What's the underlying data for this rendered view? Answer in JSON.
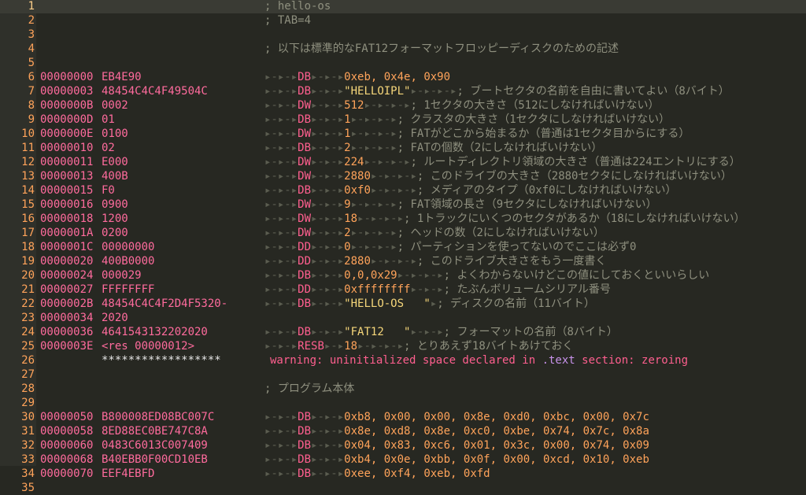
{
  "listing": [
    {
      "n": "1",
      "addr": "",
      "hex": "",
      "tab1": "",
      "dir": "",
      "tab2": "",
      "operand": "",
      "otype": "",
      "tab3": "",
      "comment": "; hello-os"
    },
    {
      "n": "2",
      "addr": "",
      "hex": "",
      "tab1": "",
      "dir": "",
      "tab2": "",
      "operand": "",
      "otype": "",
      "tab3": "",
      "comment": "; TAB=4"
    },
    {
      "n": "3",
      "addr": "",
      "hex": "",
      "tab1": "",
      "dir": "",
      "tab2": "",
      "operand": "",
      "otype": "",
      "tab3": "",
      "comment": ""
    },
    {
      "n": "4",
      "addr": "",
      "hex": "",
      "tab1": "",
      "dir": "",
      "tab2": "",
      "operand": "",
      "otype": "",
      "tab3": "",
      "comment": "; 以下は標準的なFAT12フォーマットフロッピーディスクのための記述"
    },
    {
      "n": "5",
      "addr": "",
      "hex": "",
      "tab1": "",
      "dir": "",
      "tab2": "",
      "operand": "",
      "otype": "",
      "tab3": "",
      "comment": ""
    },
    {
      "n": "6",
      "addr": "00000000",
      "hex": "EB4E90",
      "tab1": "▸-▸-▸",
      "dir": "DB",
      "tab2": "▸-▸-▸",
      "operand": "0xeb, 0x4e, 0x90",
      "otype": "num",
      "tab3": "",
      "comment": ""
    },
    {
      "n": "7",
      "addr": "00000003",
      "hex": "48454C4C4F49504C",
      "tab1": "▸-▸-▸",
      "dir": "DB",
      "tab2": "▸-▸-▸",
      "operand": "\"HELLOIPL\"",
      "otype": "str",
      "tab3": "▸-▸-▸-▸",
      "comment": "; ブートセクタの名前を自由に書いてよい（8バイト）"
    },
    {
      "n": "8",
      "addr": "0000000B",
      "hex": "0002",
      "tab1": "▸-▸-▸",
      "dir": "DW",
      "tab2": "▸-▸-▸",
      "operand": "512",
      "otype": "num",
      "tab3": "▸-▸-▸-▸",
      "comment": "; 1セクタの大きさ（512にしなければいけない）"
    },
    {
      "n": "9",
      "addr": "0000000D",
      "hex": "01",
      "tab1": "▸-▸-▸",
      "dir": "DB",
      "tab2": "▸-▸-▸",
      "operand": "1",
      "otype": "num",
      "tab3": "▸-▸-▸-▸",
      "comment": "; クラスタの大きさ（1セクタにしなければいけない）"
    },
    {
      "n": "10",
      "addr": "0000000E",
      "hex": "0100",
      "tab1": "▸-▸-▸",
      "dir": "DW",
      "tab2": "▸-▸-▸",
      "operand": "1",
      "otype": "num",
      "tab3": "▸-▸-▸-▸",
      "comment": "; FATがどこから始まるか（普通は1セクタ目からにする）"
    },
    {
      "n": "11",
      "addr": "00000010",
      "hex": "02",
      "tab1": "▸-▸-▸",
      "dir": "DB",
      "tab2": "▸-▸-▸",
      "operand": "2",
      "otype": "num",
      "tab3": "▸-▸-▸-▸",
      "comment": "; FATの個数（2にしなければいけない）"
    },
    {
      "n": "12",
      "addr": "00000011",
      "hex": "E000",
      "tab1": "▸-▸-▸",
      "dir": "DW",
      "tab2": "▸-▸-▸",
      "operand": "224",
      "otype": "num",
      "tab3": "▸-▸-▸-▸",
      "comment": "; ルートディレクトリ領域の大きさ（普通は224エントリにする）"
    },
    {
      "n": "13",
      "addr": "00000013",
      "hex": "400B",
      "tab1": "▸-▸-▸",
      "dir": "DW",
      "tab2": "▸-▸-▸",
      "operand": "2880",
      "otype": "num",
      "tab3": "▸-▸-▸-▸",
      "comment": "; このドライブの大きさ（2880セクタにしなければいけない）"
    },
    {
      "n": "14",
      "addr": "00000015",
      "hex": "F0",
      "tab1": "▸-▸-▸",
      "dir": "DB",
      "tab2": "▸-▸-▸",
      "operand": "0xf0",
      "otype": "num",
      "tab3": "▸-▸-▸-▸",
      "comment": "; メディアのタイプ（0xf0にしなければいけない）"
    },
    {
      "n": "15",
      "addr": "00000016",
      "hex": "0900",
      "tab1": "▸-▸-▸",
      "dir": "DW",
      "tab2": "▸-▸-▸",
      "operand": "9",
      "otype": "num",
      "tab3": "▸-▸-▸-▸",
      "comment": "; FAT領域の長さ（9セクタにしなければいけない）"
    },
    {
      "n": "16",
      "addr": "00000018",
      "hex": "1200",
      "tab1": "▸-▸-▸",
      "dir": "DW",
      "tab2": "▸-▸-▸",
      "operand": "18",
      "otype": "num",
      "tab3": "▸-▸-▸-▸",
      "comment": "; 1トラックにいくつのセクタがあるか（18にしなければいけない）"
    },
    {
      "n": "17",
      "addr": "0000001A",
      "hex": "0200",
      "tab1": "▸-▸-▸",
      "dir": "DW",
      "tab2": "▸-▸-▸",
      "operand": "2",
      "otype": "num",
      "tab3": "▸-▸-▸-▸",
      "comment": "; ヘッドの数（2にしなければいけない）"
    },
    {
      "n": "18",
      "addr": "0000001C",
      "hex": "00000000",
      "tab1": "▸-▸-▸",
      "dir": "DD",
      "tab2": "▸-▸-▸",
      "operand": "0",
      "otype": "num",
      "tab3": "▸-▸-▸-▸",
      "comment": "; パーティションを使ってないのでここは必ず0"
    },
    {
      "n": "19",
      "addr": "00000020",
      "hex": "400B0000",
      "tab1": "▸-▸-▸",
      "dir": "DD",
      "tab2": "▸-▸-▸",
      "operand": "2880",
      "otype": "num",
      "tab3": "▸-▸-▸-▸",
      "comment": "; このドライブ大きさをもう一度書く"
    },
    {
      "n": "20",
      "addr": "00000024",
      "hex": "000029",
      "tab1": "▸-▸-▸",
      "dir": "DB",
      "tab2": "▸-▸-▸",
      "operand": "0,0,0x29",
      "otype": "num",
      "tab3": "▸-▸-▸-▸",
      "comment": "; よくわからないけどこの値にしておくといいらしい"
    },
    {
      "n": "21",
      "addr": "00000027",
      "hex": "FFFFFFFF",
      "tab1": "▸-▸-▸",
      "dir": "DD",
      "tab2": "▸-▸-▸",
      "operand": "0xffffffff",
      "otype": "num",
      "tab3": "▸-▸-▸",
      "comment": "; たぶんボリュームシリアル番号"
    },
    {
      "n": "22",
      "addr": "0000002B",
      "hex": "48454C4C4F2D4F5320-",
      "tab1": "▸-▸-▸",
      "dir": "DB",
      "tab2": "▸-▸-▸",
      "operand": "\"HELLO-OS   \"",
      "otype": "str",
      "tab3": "▸",
      "comment": "; ディスクの名前（11バイト）"
    },
    {
      "n": "23",
      "addr": "00000034",
      "hex": "2020",
      "tab1": "",
      "dir": "",
      "tab2": "",
      "operand": "",
      "otype": "",
      "tab3": "",
      "comment": ""
    },
    {
      "n": "24",
      "addr": "00000036",
      "hex": "4641543132202020",
      "tab1": "▸-▸-▸",
      "dir": "DB",
      "tab2": "▸-▸-▸",
      "operand": "\"FAT12   \"",
      "otype": "str",
      "tab3": "▸-▸-▸",
      "comment": "; フォーマットの名前（8バイト）"
    },
    {
      "n": "25",
      "addr": "0000003E",
      "hex": "<res 00000012>",
      "tab1": "▸-▸-▸",
      "dir": "RESB",
      "tab2": "▸-▸",
      "operand": "18",
      "otype": "num",
      "tab3": "▸-▸-▸-▸",
      "comment": "; とりあえず18バイトあけておく"
    },
    {
      "n": "26",
      "addr": "",
      "hex": "******************",
      "tab1": "",
      "dir": "",
      "tab2": "",
      "operand": "",
      "otype": "",
      "tab3": "",
      "comment": "",
      "warning": true
    },
    {
      "n": "27",
      "addr": "",
      "hex": "",
      "tab1": "",
      "dir": "",
      "tab2": "",
      "operand": "",
      "otype": "",
      "tab3": "",
      "comment": ""
    },
    {
      "n": "28",
      "addr": "",
      "hex": "",
      "tab1": "",
      "dir": "",
      "tab2": "",
      "operand": "",
      "otype": "",
      "tab3": "",
      "comment": "; プログラム本体"
    },
    {
      "n": "29",
      "addr": "",
      "hex": "",
      "tab1": "",
      "dir": "",
      "tab2": "",
      "operand": "",
      "otype": "",
      "tab3": "",
      "comment": ""
    },
    {
      "n": "30",
      "addr": "00000050",
      "hex": "B800008ED08BC007C",
      "tab1": "▸-▸-▸",
      "dir": "DB",
      "tab2": "▸-▸-▸",
      "operand": "0xb8, 0x00, 0x00, 0x8e, 0xd0, 0xbc, 0x00, 0x7c",
      "otype": "num",
      "tab3": "",
      "comment": ""
    },
    {
      "n": "31",
      "addr": "00000058",
      "hex": "8ED88EC0BE747C8A",
      "tab1": "▸-▸-▸",
      "dir": "DB",
      "tab2": "▸-▸-▸",
      "operand": "0x8e, 0xd8, 0x8e, 0xc0, 0xbe, 0x74, 0x7c, 0x8a",
      "otype": "num",
      "tab3": "",
      "comment": ""
    },
    {
      "n": "32",
      "addr": "00000060",
      "hex": "0483C6013C007409",
      "tab1": "▸-▸-▸",
      "dir": "DB",
      "tab2": "▸-▸-▸",
      "operand": "0x04, 0x83, 0xc6, 0x01, 0x3c, 0x00, 0x74, 0x09",
      "otype": "num",
      "tab3": "",
      "comment": ""
    },
    {
      "n": "33",
      "addr": "00000068",
      "hex": "B40EBB0F00CD10EB",
      "tab1": "▸-▸-▸",
      "dir": "DB",
      "tab2": "▸-▸-▸",
      "operand": "0xb4, 0x0e, 0xbb, 0x0f, 0x00, 0xcd, 0x10, 0xeb",
      "otype": "num",
      "tab3": "",
      "comment": ""
    },
    {
      "n": "34",
      "addr": "00000070",
      "hex": "EEF4EBFD",
      "tab1": "▸-▸-▸",
      "dir": "DB",
      "tab2": "▸-▸-▸",
      "operand": "0xee, 0xf4, 0xeb, 0xfd",
      "otype": "num",
      "tab3": "",
      "comment": ""
    },
    {
      "n": "35",
      "addr": "",
      "hex": "",
      "tab1": "",
      "dir": "",
      "tab2": "",
      "operand": "",
      "otype": "",
      "tab3": "",
      "comment": ""
    }
  ],
  "warning": {
    "prefix": "warning: uninitialized space declared in ",
    "section": ".text",
    "suffix": " section: zeroing"
  },
  "colors": {
    "background": "#272822",
    "line_number": "#ffa35a",
    "address_hex": "#ff6b9d",
    "directive": "#ff5f8f",
    "number": "#ffa35a",
    "string": "#f5d67a",
    "comment": "#8f907f",
    "tab_marker": "#5b5d50"
  }
}
